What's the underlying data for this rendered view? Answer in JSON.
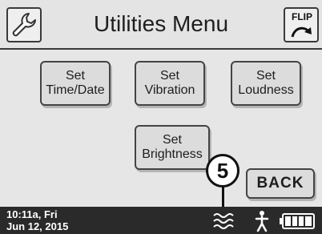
{
  "header": {
    "title": "Utilities Menu",
    "settings_icon": "wrench-icon",
    "flip_label": "FLIP",
    "flip_icon": "curved-arrow-icon"
  },
  "menu": {
    "set_time_date": [
      "Set",
      "Time/Date"
    ],
    "set_vibration": [
      "Set",
      "Vibration"
    ],
    "set_loudness": [
      "Set",
      "Loudness"
    ],
    "set_brightness": [
      "Set",
      "Brightness"
    ],
    "back": "BACK"
  },
  "callout": "5",
  "status_bar": {
    "time": "10:11a, Fri",
    "date": "Jun 12, 2015",
    "icons": [
      "vibrate-wave-icon",
      "person-icon",
      "battery-icon"
    ],
    "battery_level": 1.0
  },
  "colors": {
    "header_bg": "#e4e4e4",
    "main_bg": "#e6e6e6",
    "button_bg": "#dcdcdc",
    "status_bg": "#2a2a2a"
  }
}
